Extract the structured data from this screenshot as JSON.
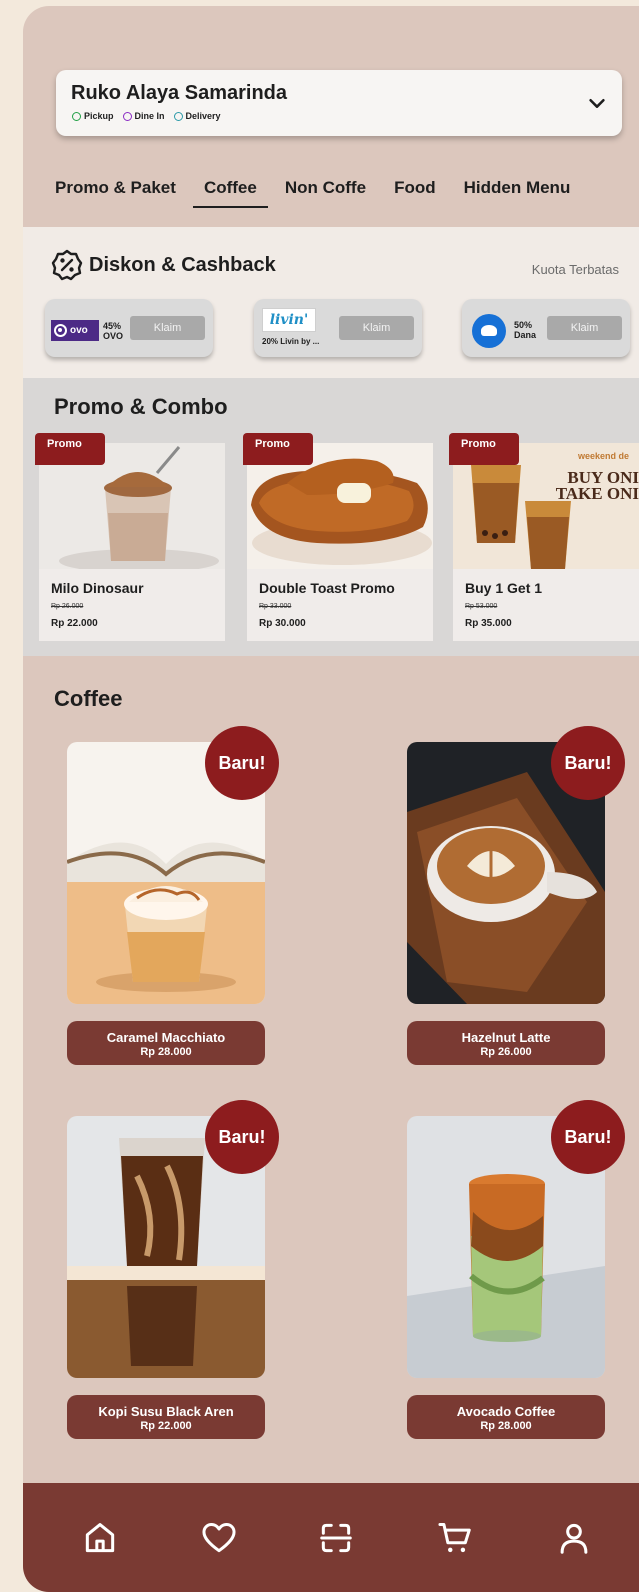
{
  "location": {
    "name": "Ruko Alaya Samarinda",
    "modes": [
      "Pickup",
      "Dine In",
      "Delivery"
    ]
  },
  "tabs": [
    "Promo & Paket",
    "Coffee",
    "Non Coffe",
    "Food",
    "Hidden Menu"
  ],
  "active_tab": "Coffee",
  "discount": {
    "title": "Diskon & Cashback",
    "quota_note": "Kuota Terbatas",
    "vouchers": [
      {
        "logo_text": "ovo",
        "pct": "45%",
        "brand": "OVO",
        "button": "Klaim"
      },
      {
        "logo_text": "livin'",
        "desc": "20% Livin by ...",
        "button": "Klaim"
      },
      {
        "pct": "50%",
        "brand": "Dana",
        "button": "Klaim"
      }
    ]
  },
  "promo": {
    "title": "Promo & Combo",
    "tag": "Promo",
    "items": [
      {
        "name": "Milo Dinosaur",
        "old_price": "Rp 26.000",
        "price": "Rp 22.000"
      },
      {
        "name": "Double Toast Promo",
        "old_price": "Rp 33.000",
        "price": "Rp 30.000"
      },
      {
        "name": "Buy 1 Get 1",
        "old_price": "Rp 53.000",
        "price": "Rp 35.000",
        "img_text": [
          "weekend de",
          "BUY ONI",
          "TAKE ONI"
        ]
      }
    ]
  },
  "coffee": {
    "title": "Coffee",
    "badge": "Baru!",
    "items": [
      {
        "name": "Caramel Macchiato",
        "price": "Rp 28.000"
      },
      {
        "name": "Hazelnut Latte",
        "price": "Rp 26.000"
      },
      {
        "name": "Kopi Susu Black Aren",
        "price": "Rp 22.000"
      },
      {
        "name": "Avocado Coffee",
        "price": "Rp 28.000"
      }
    ]
  },
  "nav": [
    "home-icon",
    "heart-icon",
    "scan-icon",
    "cart-icon",
    "user-icon"
  ],
  "colors": {
    "brand": "#7a3a33",
    "badge": "#8d1c1e",
    "background": "#dcc7bd"
  }
}
